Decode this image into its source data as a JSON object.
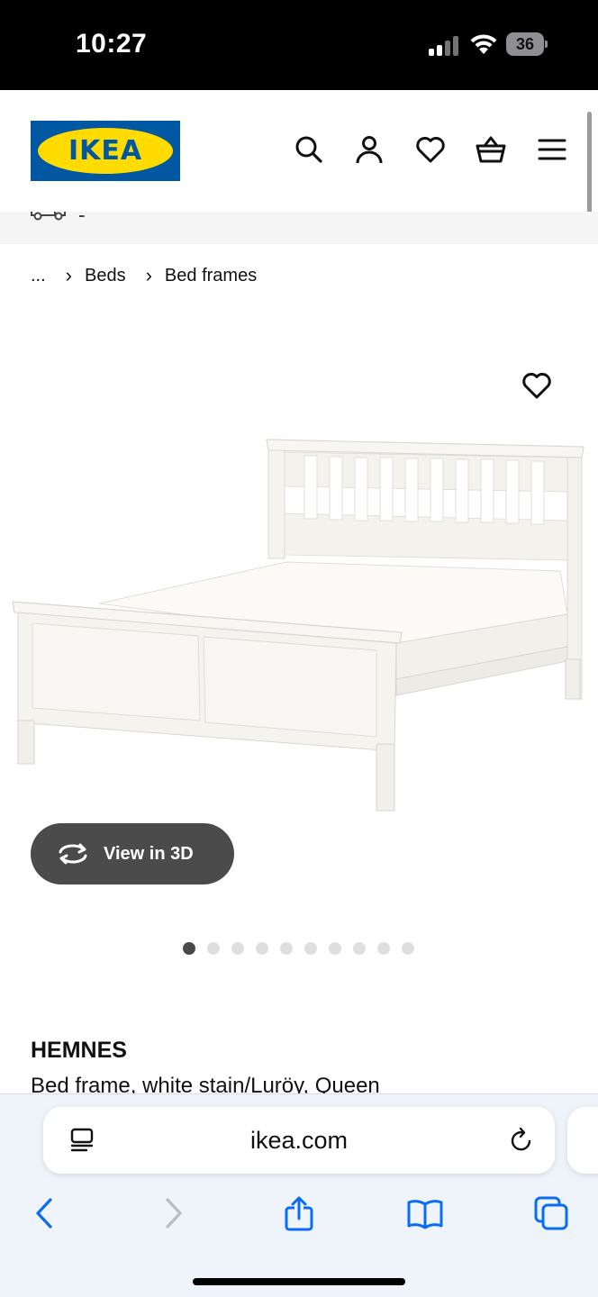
{
  "status_bar": {
    "time": "10:27",
    "battery": "36"
  },
  "header": {
    "logo_text": "IKEA",
    "brand_colors": {
      "blue": "#0058a3",
      "yellow": "#ffdb00"
    },
    "icons": [
      "search-icon",
      "account-icon",
      "favourites-icon",
      "cart-icon",
      "menu-icon"
    ]
  },
  "breadcrumb": {
    "ellipsis": "...",
    "items": [
      "Beds",
      "Bed frames"
    ]
  },
  "media": {
    "view_3d_label": "View in 3D",
    "image_count": 10,
    "active_image": 1
  },
  "product": {
    "name": "HEMNES",
    "description": "Bed frame, white stain/Luröy, Queen"
  },
  "browser": {
    "url": "ikea.com",
    "icons": [
      "reader-icon",
      "reload-icon",
      "back-icon",
      "forward-icon",
      "share-icon",
      "bookmarks-icon",
      "tabs-icon"
    ]
  }
}
